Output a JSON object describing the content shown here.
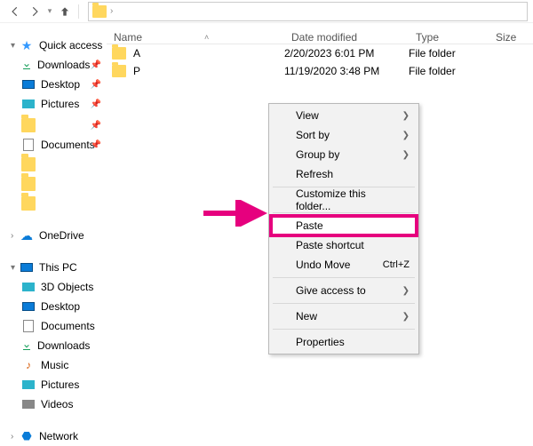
{
  "toolbar": {
    "addr_chevron": "›"
  },
  "headers": {
    "name": "Name",
    "date": "Date modified",
    "type": "Type",
    "size": "Size"
  },
  "sidebar": {
    "quick_access": "Quick access",
    "downloads": "Downloads",
    "desktop": "Desktop",
    "pictures": "Pictures",
    "documents": "Documents",
    "onedrive": "OneDrive",
    "this_pc": "This PC",
    "objects3d": "3D Objects",
    "sb_desktop": "Desktop",
    "sb_documents": "Documents",
    "sb_downloads": "Downloads",
    "music": "Music",
    "sb_pictures": "Pictures",
    "videos": "Videos",
    "network": "Network"
  },
  "files": [
    {
      "name": "A",
      "date": "2/20/2023 6:01 PM",
      "type": "File folder"
    },
    {
      "name": "P",
      "date": "11/19/2020 3:48 PM",
      "type": "File folder"
    }
  ],
  "ctx": {
    "view": "View",
    "sort_by": "Sort by",
    "group_by": "Group by",
    "refresh": "Refresh",
    "customize": "Customize this folder...",
    "paste": "Paste",
    "paste_shortcut": "Paste shortcut",
    "undo_move": "Undo Move",
    "undo_key": "Ctrl+Z",
    "give_access": "Give access to",
    "new": "New",
    "properties": "Properties"
  }
}
